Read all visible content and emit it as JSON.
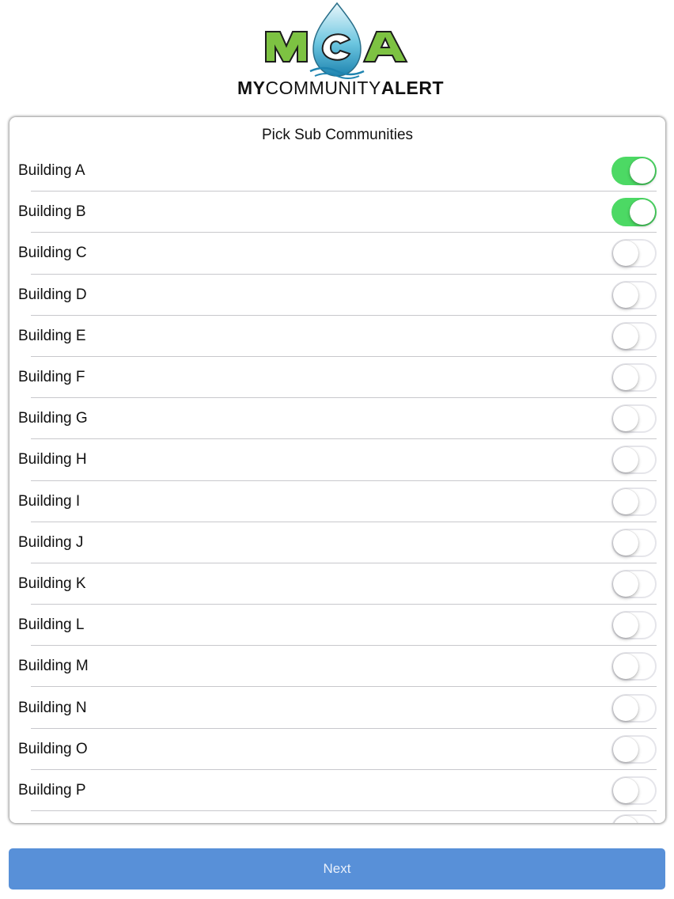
{
  "logo": {
    "monogram": "MCA",
    "wordmark_bold_1": "MY",
    "wordmark_regular": "COMMUNITY",
    "wordmark_bold_2": "ALERT"
  },
  "card": {
    "title": "Pick Sub Communities",
    "items": [
      {
        "label": "Building A",
        "on": true
      },
      {
        "label": "Building B",
        "on": true
      },
      {
        "label": "Building C",
        "on": false
      },
      {
        "label": "Building D",
        "on": false
      },
      {
        "label": "Building E",
        "on": false
      },
      {
        "label": "Building F",
        "on": false
      },
      {
        "label": "Building G",
        "on": false
      },
      {
        "label": "Building H",
        "on": false
      },
      {
        "label": "Building I",
        "on": false
      },
      {
        "label": "Building J",
        "on": false
      },
      {
        "label": "Building K",
        "on": false
      },
      {
        "label": "Building L",
        "on": false
      },
      {
        "label": "Building M",
        "on": false
      },
      {
        "label": "Building N",
        "on": false
      },
      {
        "label": "Building O",
        "on": false
      },
      {
        "label": "Building P",
        "on": false
      }
    ]
  },
  "next_button": {
    "label": "Next"
  },
  "colors": {
    "toggle_on": "#4cd964",
    "button": "#5890d8",
    "logo_green": "#7dc242",
    "logo_blue": "#3aa8c8"
  }
}
